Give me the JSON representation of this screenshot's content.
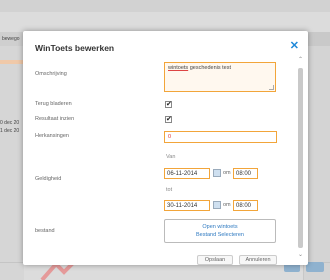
{
  "background": {
    "tab_left": "bewego",
    "row_text_1": "0 dec 20",
    "row_text_2": "1 dec 20",
    "right_button_label": "",
    "accent_color": "#8fb2cf"
  },
  "modal": {
    "title": "WinToets bewerken",
    "close_symbol": "✕",
    "fields": {
      "omschrijving_label": "Omschrijving",
      "omschrijving_value_word1": "wintoets",
      "omschrijving_value_rest": " geschedenis test",
      "terug_bladeren_label": "Terug bladeren",
      "terug_bladeren_checked": "✔",
      "resultaat_inzien_label": "Resultaat inzien",
      "resultaat_inzien_checked": "✔",
      "herkansingen_label": "Herkansingen",
      "herkansingen_value": "0",
      "geldigheid_label": "Geldigheid",
      "van_label": "Van",
      "tot_label": "tot",
      "van_date": "06-11-2014",
      "van_om": "om",
      "van_time": "08:00",
      "tot_date": "30-11-2014",
      "tot_om": "om",
      "tot_time": "08:00",
      "bestand_label": "bestand",
      "open_file_link": "Open wintoets",
      "select_file_link": "Bestand Selecteren"
    },
    "footer": {
      "save_label": "Opslaan",
      "cancel_label": "Annuleren"
    }
  }
}
